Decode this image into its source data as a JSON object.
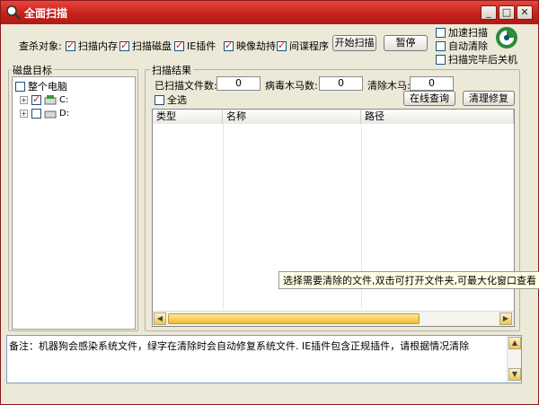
{
  "window": {
    "title": "全面扫描",
    "controls": {
      "minimize": "_",
      "maximize": "□",
      "close": "✕"
    }
  },
  "options": {
    "label": "查杀对象:",
    "items": [
      {
        "label": "扫描内存",
        "checked": true
      },
      {
        "label": "扫描磁盘",
        "checked": true
      },
      {
        "label": "IE插件",
        "checked": true
      },
      {
        "label": "映像劫持",
        "checked": true
      },
      {
        "label": "间谍程序",
        "checked": true
      }
    ],
    "start_button": "开始扫描",
    "pause_button": "暂停",
    "extra": [
      {
        "label": "加速扫描",
        "checked": false
      },
      {
        "label": "自动清除",
        "checked": false
      },
      {
        "label": "扫描完毕后关机",
        "checked": false
      }
    ]
  },
  "disk": {
    "title": "磁盘目标",
    "whole_pc": {
      "label": "整个电脑",
      "checked": false
    },
    "drives": [
      {
        "label": "C:",
        "checked": true
      },
      {
        "label": "D:",
        "checked": false
      }
    ]
  },
  "results": {
    "title": "扫描结果",
    "scanned_label": "已扫描文件数:",
    "scanned_value": "0",
    "virus_label": "病毒木马数:",
    "virus_value": "0",
    "cleared_label": "清除木马:",
    "cleared_value": "0",
    "select_all": {
      "label": "全选",
      "checked": false
    },
    "online_button": "在线查询",
    "repair_button": "清理修复",
    "columns": [
      "类型",
      "名称",
      "路径"
    ],
    "tooltip": "选择需要清除的文件,双击可打开文件夹,可最大化窗口查看"
  },
  "note": "备注：机器狗会感染系统文件，绿字在清除时会自动修复系统文件. IE插件包含正规插件，请根据情况清除",
  "colors": {
    "titlebar": "#c6211c",
    "scrollbar": "#f0c54c"
  }
}
